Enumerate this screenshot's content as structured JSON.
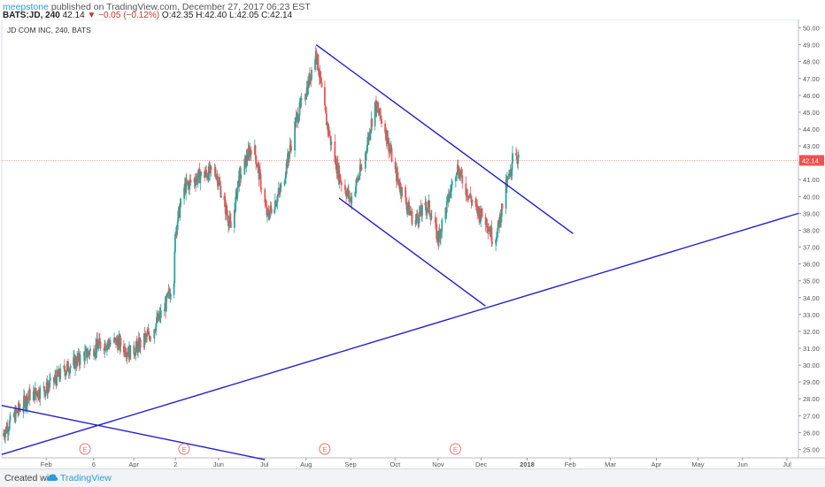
{
  "header": {
    "author": "meepstone",
    "published_text": " published on TradingView.com, December 27, 2017 06:23 EST",
    "symbol_interval": "BATS:JD, 240",
    "last_price": "42.14",
    "change": "−0.05 (−0.12%)",
    "ohlc": "O:42.35 H:42.40 L:42.05 C:42.14"
  },
  "footer": {
    "created_label": "Created with",
    "brand": "TradingView"
  },
  "colors": {
    "up": "#26a69a",
    "down": "#ef5350",
    "trendline": "#1f1fcc",
    "price_tag": "#ef5350",
    "earnings": "#e57373"
  },
  "chart_data": {
    "type": "candlestick",
    "title": "JD COM INC, 240, BATS",
    "price_axis": {
      "min": 24.5,
      "max": 50.5,
      "ticks": [
        "25.00",
        "26.00",
        "27.00",
        "28.00",
        "29.00",
        "30.00",
        "31.00",
        "32.00",
        "33.00",
        "34.00",
        "35.00",
        "36.00",
        "37.00",
        "38.00",
        "39.00",
        "40.00",
        "41.00",
        "42.00",
        "43.00",
        "44.00",
        "45.00",
        "46.00",
        "47.00",
        "48.00",
        "49.00",
        "50.00"
      ]
    },
    "time_axis": {
      "start": "2017-01-01",
      "end": "2018-07-10",
      "tick_labels": [
        {
          "label": "Feb",
          "date": "2017-02-01"
        },
        {
          "label": "6",
          "date": "2017-03-06"
        },
        {
          "label": "Apr",
          "date": "2017-04-03"
        },
        {
          "label": "2",
          "date": "2017-05-02"
        },
        {
          "label": "Jun",
          "date": "2017-06-01"
        },
        {
          "label": "Jul",
          "date": "2017-07-03"
        },
        {
          "label": "Aug",
          "date": "2017-08-01"
        },
        {
          "label": "Sep",
          "date": "2017-09-01"
        },
        {
          "label": "Oct",
          "date": "2017-10-02"
        },
        {
          "label": "Nov",
          "date": "2017-11-01"
        },
        {
          "label": "Dec",
          "date": "2017-12-01"
        },
        {
          "label": "2018",
          "date": "2018-01-02"
        },
        {
          "label": "Feb",
          "date": "2018-02-01"
        },
        {
          "label": "Mar",
          "date": "2018-03-01"
        },
        {
          "label": "Apr",
          "date": "2018-04-02"
        },
        {
          "label": "May",
          "date": "2018-05-01"
        },
        {
          "label": "Jun",
          "date": "2018-06-01"
        },
        {
          "label": "Jul",
          "date": "2018-07-02"
        }
      ]
    },
    "price_path": [
      [
        "2017-01-01",
        25.8
      ],
      [
        "2017-01-10",
        27.0
      ],
      [
        "2017-01-20",
        28.2
      ],
      [
        "2017-02-01",
        28.6
      ],
      [
        "2017-02-15",
        29.8
      ],
      [
        "2017-02-28",
        30.6
      ],
      [
        "2017-03-10",
        31.2
      ],
      [
        "2017-03-22",
        31.4
      ],
      [
        "2017-04-01",
        30.7
      ],
      [
        "2017-04-15",
        31.9
      ],
      [
        "2017-04-25",
        33.5
      ],
      [
        "2017-05-01",
        35.2
      ],
      [
        "2017-05-02",
        38.0
      ],
      [
        "2017-05-08",
        40.5
      ],
      [
        "2017-05-18",
        41.2
      ],
      [
        "2017-05-30",
        41.5
      ],
      [
        "2017-06-10",
        38.0
      ],
      [
        "2017-06-15",
        41.0
      ],
      [
        "2017-06-25",
        43.2
      ],
      [
        "2017-07-05",
        38.8
      ],
      [
        "2017-07-15",
        40.5
      ],
      [
        "2017-07-25",
        44.5
      ],
      [
        "2017-08-02",
        46.5
      ],
      [
        "2017-08-08",
        48.6
      ],
      [
        "2017-08-14",
        45.0
      ],
      [
        "2017-08-20",
        42.5
      ],
      [
        "2017-08-25",
        41.0
      ],
      [
        "2017-09-01",
        39.8
      ],
      [
        "2017-09-10",
        42.0
      ],
      [
        "2017-09-18",
        45.5
      ],
      [
        "2017-09-25",
        44.0
      ],
      [
        "2017-10-02",
        41.5
      ],
      [
        "2017-10-08",
        40.0
      ],
      [
        "2017-10-15",
        38.5
      ],
      [
        "2017-10-25",
        39.5
      ],
      [
        "2017-11-01",
        37.5
      ],
      [
        "2017-11-08",
        39.8
      ],
      [
        "2017-11-14",
        41.8
      ],
      [
        "2017-11-20",
        40.5
      ],
      [
        "2017-11-28",
        39.2
      ],
      [
        "2017-12-05",
        38.5
      ],
      [
        "2017-12-10",
        37.3
      ],
      [
        "2017-12-13",
        38.2
      ],
      [
        "2017-12-18",
        40.5
      ],
      [
        "2017-12-22",
        41.5
      ],
      [
        "2017-12-23",
        43.1
      ],
      [
        "2017-12-27",
        42.14
      ]
    ],
    "last_price": 42.14,
    "trendlines": [
      {
        "from": [
          "2017-08-08",
          49.0
        ],
        "to": [
          "2018-02-03",
          37.8
        ]
      },
      {
        "from": [
          "2017-08-24",
          39.9
        ],
        "to": [
          "2017-12-04",
          33.5
        ]
      },
      {
        "from": [
          "2017-01-01",
          24.7
        ],
        "to": [
          "2018-07-10",
          39.0
        ]
      },
      {
        "from": [
          "2017-01-01",
          27.6
        ],
        "to": [
          "2017-07-03",
          24.4
        ]
      }
    ],
    "earnings": [
      {
        "label": "E",
        "date": "2017-02-28"
      },
      {
        "label": "E",
        "date": "2017-05-08"
      },
      {
        "label": "E",
        "date": "2017-08-14"
      },
      {
        "label": "E",
        "date": "2017-11-13"
      }
    ]
  }
}
